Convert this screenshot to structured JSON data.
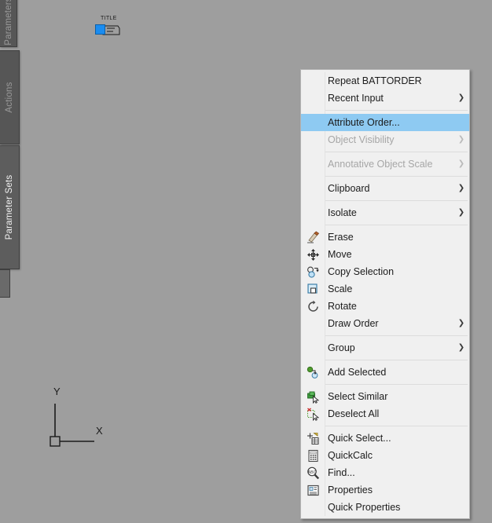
{
  "canvas": {
    "background_color": "#9e9e9e",
    "block": {
      "attribute_text": "TITLE",
      "grip_color": "#1a8cf0"
    },
    "ucs": {
      "x_label": "X",
      "y_label": "Y"
    }
  },
  "sidebar": {
    "tabs": [
      {
        "label": "Parameters",
        "active": false
      },
      {
        "label": "Actions",
        "active": false
      },
      {
        "label": "Parameter Sets",
        "active": true
      }
    ]
  },
  "context_menu": {
    "highlight_color": "#8ecaf2",
    "background_color": "#f0f0f0",
    "items": [
      {
        "label": "Repeat BATTORDER",
        "icon": "",
        "submenu": false,
        "disabled": false,
        "highlighted": false
      },
      {
        "label": "Recent Input",
        "icon": "",
        "submenu": true,
        "disabled": false,
        "highlighted": false
      },
      {
        "separator": true
      },
      {
        "label": "Attribute Order...",
        "icon": "",
        "submenu": false,
        "disabled": false,
        "highlighted": true
      },
      {
        "label": "Object Visibility",
        "icon": "",
        "submenu": true,
        "disabled": true,
        "highlighted": false
      },
      {
        "separator": true
      },
      {
        "label": "Annotative Object Scale",
        "icon": "",
        "submenu": true,
        "disabled": true,
        "highlighted": false
      },
      {
        "separator": true
      },
      {
        "label": "Clipboard",
        "icon": "",
        "submenu": true,
        "disabled": false,
        "highlighted": false
      },
      {
        "separator": true
      },
      {
        "label": "Isolate",
        "icon": "",
        "submenu": true,
        "disabled": false,
        "highlighted": false
      },
      {
        "separator": true
      },
      {
        "label": "Erase",
        "icon": "erase-icon",
        "submenu": false,
        "disabled": false,
        "highlighted": false
      },
      {
        "label": "Move",
        "icon": "move-icon",
        "submenu": false,
        "disabled": false,
        "highlighted": false
      },
      {
        "label": "Copy Selection",
        "icon": "copy-selection-icon",
        "submenu": false,
        "disabled": false,
        "highlighted": false
      },
      {
        "label": "Scale",
        "icon": "scale-icon",
        "submenu": false,
        "disabled": false,
        "highlighted": false
      },
      {
        "label": "Rotate",
        "icon": "rotate-icon",
        "submenu": false,
        "disabled": false,
        "highlighted": false
      },
      {
        "label": "Draw Order",
        "icon": "",
        "submenu": true,
        "disabled": false,
        "highlighted": false
      },
      {
        "separator": true
      },
      {
        "label": "Group",
        "icon": "",
        "submenu": true,
        "disabled": false,
        "highlighted": false
      },
      {
        "separator": true
      },
      {
        "label": "Add Selected",
        "icon": "add-selected-icon",
        "submenu": false,
        "disabled": false,
        "highlighted": false
      },
      {
        "separator": true
      },
      {
        "label": "Select Similar",
        "icon": "select-similar-icon",
        "submenu": false,
        "disabled": false,
        "highlighted": false
      },
      {
        "label": "Deselect All",
        "icon": "deselect-all-icon",
        "submenu": false,
        "disabled": false,
        "highlighted": false
      },
      {
        "separator": true
      },
      {
        "label": "Quick Select...",
        "icon": "quick-select-icon",
        "submenu": false,
        "disabled": false,
        "highlighted": false
      },
      {
        "label": "QuickCalc",
        "icon": "quickcalc-icon",
        "submenu": false,
        "disabled": false,
        "highlighted": false
      },
      {
        "label": "Find...",
        "icon": "find-icon",
        "submenu": false,
        "disabled": false,
        "highlighted": false
      },
      {
        "label": "Properties",
        "icon": "properties-icon",
        "submenu": false,
        "disabled": false,
        "highlighted": false
      },
      {
        "label": "Quick Properties",
        "icon": "",
        "submenu": false,
        "disabled": false,
        "highlighted": false
      }
    ]
  }
}
